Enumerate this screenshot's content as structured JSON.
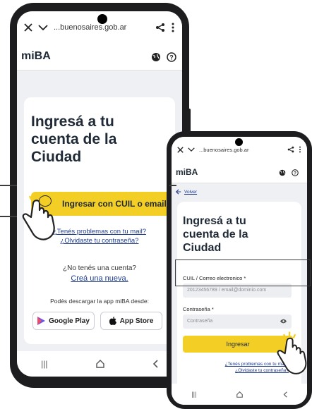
{
  "phone1": {
    "browser": {
      "url": "...buenosaires.gob.ar"
    },
    "brand": "miBA",
    "title_lines": [
      "Ingresá a tu",
      "cuenta de la",
      "Ciudad"
    ],
    "login_button": "Ingresar con CUIL o email",
    "problems_link": "¿Tenés problemas con tu mail?",
    "forgot_link": "¿Olvidaste tu contraseña?",
    "no_account": "¿No tenés una cuenta?",
    "create_link": "Creá una nueva.",
    "download_text": "Podés descargar la app miBA desde:",
    "google_play": "Google Play",
    "app_store": "App Store"
  },
  "phone2": {
    "browser": {
      "url": "...buenosaires.gob.ar"
    },
    "brand": "miBA",
    "back_link": "Volver",
    "title_lines": [
      "Ingresá a tu",
      "cuenta de la",
      "Ciudad"
    ],
    "cuil_label": "CUIL / Correo electronico *",
    "cuil_placeholder": "20123456789 / email@dominio.com",
    "password_label": "Contraseña *",
    "password_placeholder": "Contraseña",
    "submit_button": "Ingresar",
    "problems_link": "¿Tenés problemas con tu mail?",
    "forgot_link": "¿Olvidaste tu contraseña?"
  },
  "colors": {
    "accent": "#f3cf26",
    "link": "#1f3c8f",
    "frame": "#1d1d1f"
  },
  "icons": [
    "close-icon",
    "chevron-down-icon",
    "share-icon",
    "more-vert-icon",
    "globe-icon",
    "help-icon",
    "back-arrow-icon",
    "eye-icon",
    "google-play-icon",
    "apple-icon",
    "hand-pointer-icon"
  ]
}
